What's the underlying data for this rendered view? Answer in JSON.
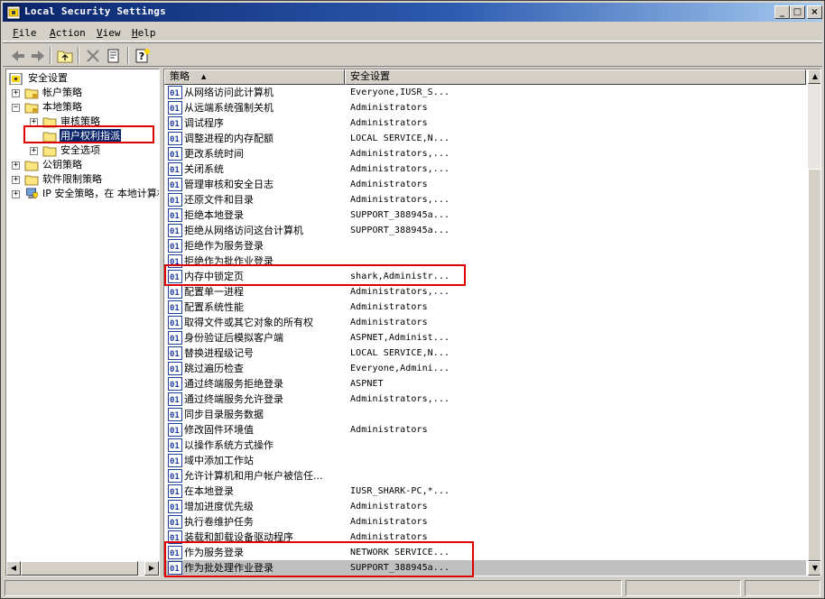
{
  "window": {
    "title": "Local Security Settings"
  },
  "menu": [
    {
      "label": "File",
      "key": "F"
    },
    {
      "label": "Action",
      "key": "A"
    },
    {
      "label": "View",
      "key": "V"
    },
    {
      "label": "Help",
      "key": "H"
    }
  ],
  "tree": {
    "root": "安全设置",
    "account_policies": "帐户策略",
    "local_policies": "本地策略",
    "audit_policy": "审核策略",
    "user_rights": "用户权利指派",
    "security_options": "安全选项",
    "public_key": "公钥策略",
    "software_restriction": "软件限制策略",
    "ip_security": "IP 安全策略，在 本地计算机"
  },
  "columns": {
    "policy": "策略",
    "setting": "安全设置",
    "sort_indicator": "▲"
  },
  "rows": [
    {
      "policy": "从网络访问此计算机",
      "setting": "Everyone,IUSR_S..."
    },
    {
      "policy": "从远端系统强制关机",
      "setting": "Administrators"
    },
    {
      "policy": "调试程序",
      "setting": "Administrators"
    },
    {
      "policy": "调整进程的内存配额",
      "setting": "LOCAL SERVICE,N..."
    },
    {
      "policy": "更改系统时间",
      "setting": "Administrators,..."
    },
    {
      "policy": "关闭系统",
      "setting": "Administrators,..."
    },
    {
      "policy": "管理审核和安全日志",
      "setting": "Administrators"
    },
    {
      "policy": "还原文件和目录",
      "setting": "Administrators,..."
    },
    {
      "policy": "拒绝本地登录",
      "setting": "SUPPORT_388945a..."
    },
    {
      "policy": "拒绝从网络访问这台计算机",
      "setting": "SUPPORT_388945a..."
    },
    {
      "policy": "拒绝作为服务登录",
      "setting": ""
    },
    {
      "policy": "拒绝作为批作业登录",
      "setting": ""
    },
    {
      "policy": "内存中锁定页",
      "setting": "shark,Administr..."
    },
    {
      "policy": "配置单一进程",
      "setting": "Administrators,..."
    },
    {
      "policy": "配置系统性能",
      "setting": "Administrators"
    },
    {
      "policy": "取得文件或其它对象的所有权",
      "setting": "Administrators"
    },
    {
      "policy": "身份验证后模拟客户端",
      "setting": "ASPNET,Administ..."
    },
    {
      "policy": "替换进程级记号",
      "setting": "LOCAL SERVICE,N..."
    },
    {
      "policy": "跳过遍历检查",
      "setting": "Everyone,Admini..."
    },
    {
      "policy": "通过终端服务拒绝登录",
      "setting": "ASPNET"
    },
    {
      "policy": "通过终端服务允许登录",
      "setting": "Administrators,..."
    },
    {
      "policy": "同步目录服务数据",
      "setting": ""
    },
    {
      "policy": "修改固件环境值",
      "setting": "Administrators"
    },
    {
      "policy": "以操作系统方式操作",
      "setting": ""
    },
    {
      "policy": "域中添加工作站",
      "setting": ""
    },
    {
      "policy": "允许计算机和用户帐户被信任...",
      "setting": ""
    },
    {
      "policy": "在本地登录",
      "setting": "IUSR_SHARK-PC,*..."
    },
    {
      "policy": "增加进度优先级",
      "setting": "Administrators"
    },
    {
      "policy": "执行卷维护任务",
      "setting": "Administrators"
    },
    {
      "policy": "装载和卸载设备驱动程序",
      "setting": "Administrators"
    },
    {
      "policy": "作为服务登录",
      "setting": "NETWORK SERVICE..."
    },
    {
      "policy": "作为批处理作业登录",
      "setting": "SUPPORT_388945a..."
    }
  ],
  "colors": {
    "highlight": "#e00000",
    "selection": "#0a246a",
    "titlebar": "#0a246a"
  }
}
